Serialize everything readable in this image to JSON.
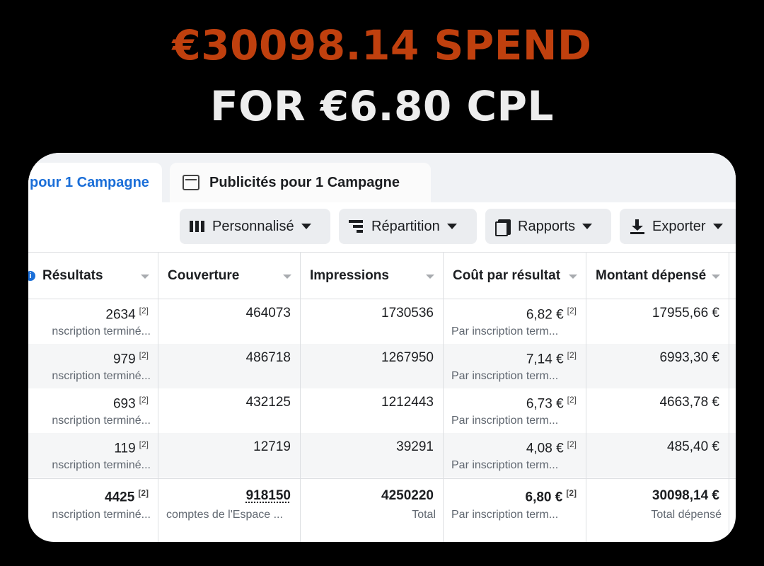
{
  "headline": {
    "line1": "€30098.14 SPEND",
    "line2": "FOR €6.80 CPL",
    "line1_color": "#c0400e"
  },
  "tabs": [
    {
      "label": "pour 1 Campagne",
      "active": true
    },
    {
      "label": "Publicités pour 1 Campagne",
      "active": false,
      "icon": "ad-window-icon"
    }
  ],
  "toolbar": {
    "personnalise": "Personnalisé",
    "repartition": "Répartition",
    "rapports": "Rapports",
    "exporter": "Exporter"
  },
  "columns": {
    "resultats": "Résultats",
    "couverture": "Couverture",
    "impressions": "Impressions",
    "cout": "Coût par résultat",
    "montant": "Montant dépensé"
  },
  "rows": [
    {
      "resultats": "2634",
      "resultats_note": "[2]",
      "resultats_sub": "nscription terminé...",
      "couverture": "464073",
      "impressions": "1730536",
      "cout": "6,82 €",
      "cout_note": "[2]",
      "cout_sub": "Par inscription term...",
      "montant": "17955,66 €"
    },
    {
      "resultats": "979",
      "resultats_note": "[2]",
      "resultats_sub": "nscription terminé...",
      "couverture": "486718",
      "impressions": "1267950",
      "cout": "7,14 €",
      "cout_note": "[2]",
      "cout_sub": "Par inscription term...",
      "montant": "6993,30 €"
    },
    {
      "resultats": "693",
      "resultats_note": "[2]",
      "resultats_sub": "nscription terminé...",
      "couverture": "432125",
      "impressions": "1212443",
      "cout": "6,73 €",
      "cout_note": "[2]",
      "cout_sub": "Par inscription term...",
      "montant": "4663,78 €"
    },
    {
      "resultats": "119",
      "resultats_note": "[2]",
      "resultats_sub": "nscription terminé...",
      "couverture": "12719",
      "impressions": "39291",
      "cout": "4,08 €",
      "cout_note": "[2]",
      "cout_sub": "Par inscription term...",
      "montant": "485,40 €"
    }
  ],
  "total": {
    "resultats": "4425",
    "resultats_note": "[2]",
    "resultats_sub": "nscription terminé...",
    "couverture": "918150",
    "couverture_sub": "comptes de l'Espace ...",
    "impressions": "4250220",
    "impressions_sub": "Total",
    "cout": "6,80 €",
    "cout_note": "[2]",
    "cout_sub": "Par inscription term...",
    "montant": "30098,14 €",
    "montant_sub": "Total dépensé"
  }
}
